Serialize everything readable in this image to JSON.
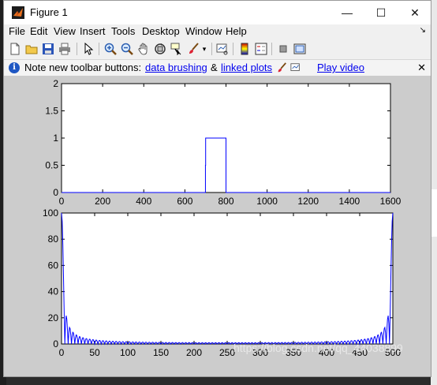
{
  "window": {
    "title": "Figure 1",
    "controls": {
      "minimize": "—",
      "maximize": "☐",
      "close": "✕"
    }
  },
  "menu": {
    "items": [
      "File",
      "Edit",
      "View",
      "Insert",
      "Tools",
      "Desktop",
      "Window",
      "Help"
    ],
    "dock_arrow": "↘"
  },
  "toolbar": {
    "buttons": [
      "new-figure",
      "open-file",
      "save",
      "print",
      "edit-plot",
      "zoom-in",
      "zoom-out",
      "pan",
      "rotate-3d",
      "data-cursor",
      "brush",
      "link-plot",
      "insert-colorbar",
      "insert-legend",
      "hide-plot-tools",
      "show-plot-tools"
    ]
  },
  "notebar": {
    "text_prefix": "Note new toolbar buttons:",
    "link_brushing": "data brushing",
    "amp": "&",
    "link_linked": "linked plots",
    "link_video": "Play video",
    "close": "✕"
  },
  "watermark": "https://blog.csdn.net/qq_44038899",
  "chart_data": [
    {
      "type": "line",
      "title": "",
      "xlabel": "",
      "ylabel": "",
      "xlim": [
        0,
        1600
      ],
      "ylim": [
        0,
        2
      ],
      "xticks": [
        0,
        200,
        400,
        600,
        800,
        1000,
        1200,
        1400,
        1600
      ],
      "yticks": [
        0,
        0.5,
        1,
        1.5,
        2
      ],
      "series": [
        {
          "color": "#0000ff",
          "x": [
            0,
            700,
            700,
            701,
            701,
            800,
            800,
            1600
          ],
          "y": [
            0,
            0,
            0.5,
            0.5,
            1,
            1,
            0,
            0
          ]
        }
      ]
    },
    {
      "type": "line",
      "title": "",
      "xlabel": "",
      "ylabel": "",
      "xlim": [
        0,
        500
      ],
      "ylim": [
        0,
        100
      ],
      "xticks": [
        0,
        50,
        100,
        150,
        200,
        250,
        300,
        350,
        400,
        450,
        500
      ],
      "yticks": [
        0,
        20,
        40,
        60,
        80,
        100
      ],
      "series": [
        {
          "color": "#0000ff",
          "description_of_shape": "sinc magnitude spectrum",
          "peak": 100,
          "n": 500
        }
      ]
    }
  ]
}
